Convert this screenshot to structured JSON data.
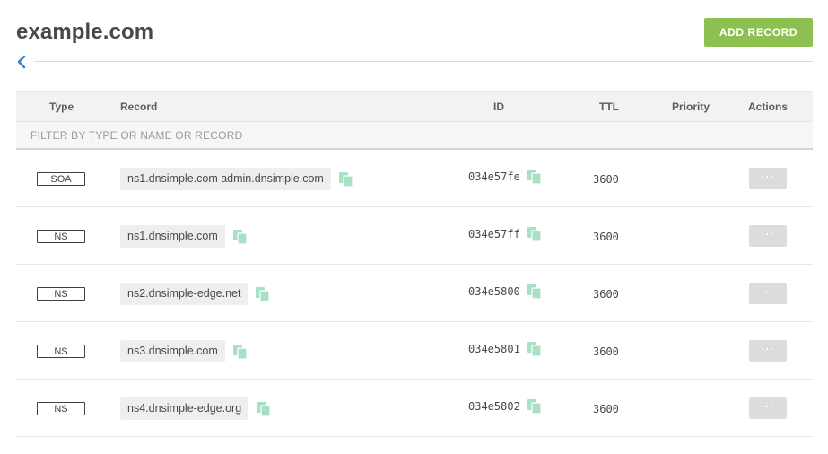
{
  "header": {
    "title": "example.com",
    "add_record_label": "ADD RECORD",
    "back_icon": "chevron-left-icon"
  },
  "table": {
    "columns": {
      "type": "Type",
      "record": "Record",
      "id": "ID",
      "ttl": "TTL",
      "priority": "Priority",
      "actions": "Actions"
    },
    "filter_placeholder": "FILTER BY TYPE OR NAME OR RECORD",
    "rows": [
      {
        "type": "SOA",
        "record": "ns1.dnsimple.com admin.dnsimple.com",
        "id": "034e57fe",
        "ttl": "3600",
        "priority": "",
        "actions_label": "···"
      },
      {
        "type": "NS",
        "record": "ns1.dnsimple.com",
        "id": "034e57ff",
        "ttl": "3600",
        "priority": "",
        "actions_label": "···"
      },
      {
        "type": "NS",
        "record": "ns2.dnsimple-edge.net",
        "id": "034e5800",
        "ttl": "3600",
        "priority": "",
        "actions_label": "···"
      },
      {
        "type": "NS",
        "record": "ns3.dnsimple.com",
        "id": "034e5801",
        "ttl": "3600",
        "priority": "",
        "actions_label": "···"
      },
      {
        "type": "NS",
        "record": "ns4.dnsimple-edge.org",
        "id": "034e5802",
        "ttl": "3600",
        "priority": "",
        "actions_label": "···"
      }
    ]
  },
  "colors": {
    "accent": "#8cc152",
    "copy_icon": "#a8e0c4",
    "back_icon": "#3b7dd8",
    "action_button": "#dcdcdc"
  },
  "icons": {
    "copy": "copy-icon"
  }
}
